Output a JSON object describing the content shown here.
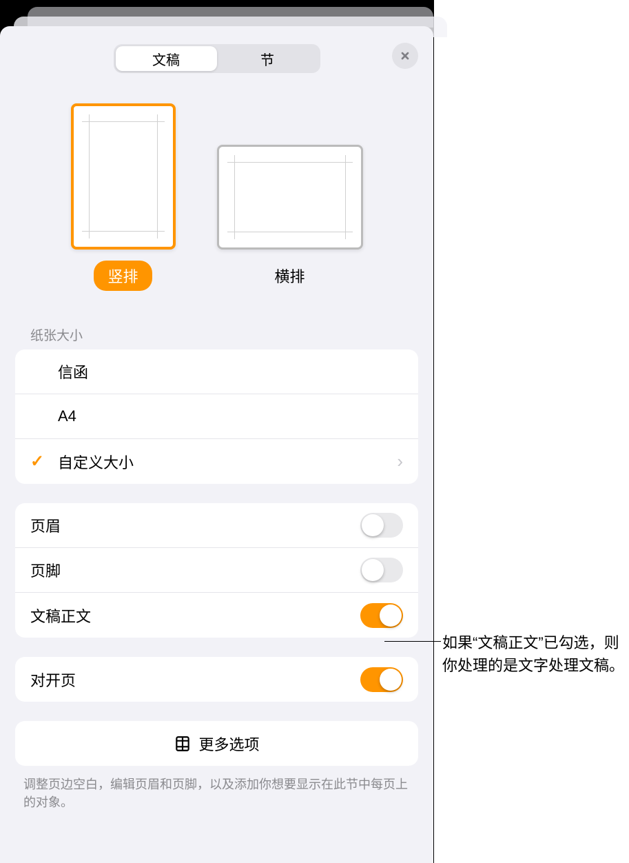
{
  "tabs": {
    "document": "文稿",
    "section": "节"
  },
  "orientation": {
    "portrait": "竖排",
    "landscape": "横排",
    "selected": "portrait"
  },
  "paperSize": {
    "label": "纸张大小",
    "options": [
      {
        "name": "信函",
        "selected": false
      },
      {
        "name": "A4",
        "selected": false
      },
      {
        "name": "自定义大小",
        "selected": true,
        "hasChevron": true
      }
    ]
  },
  "toggles": {
    "header": {
      "label": "页眉",
      "on": false
    },
    "footer": {
      "label": "页脚",
      "on": false
    },
    "documentBody": {
      "label": "文稿正文",
      "on": true
    },
    "facingPages": {
      "label": "对开页",
      "on": true
    }
  },
  "moreOptions": "更多选项",
  "footerText": "调整页边空白，编辑页眉和页脚，以及添加你想要显示在此节中每页上的对象。",
  "callout": "如果“文稿正文”已勾选，则你处理的是文字处理文稿。"
}
